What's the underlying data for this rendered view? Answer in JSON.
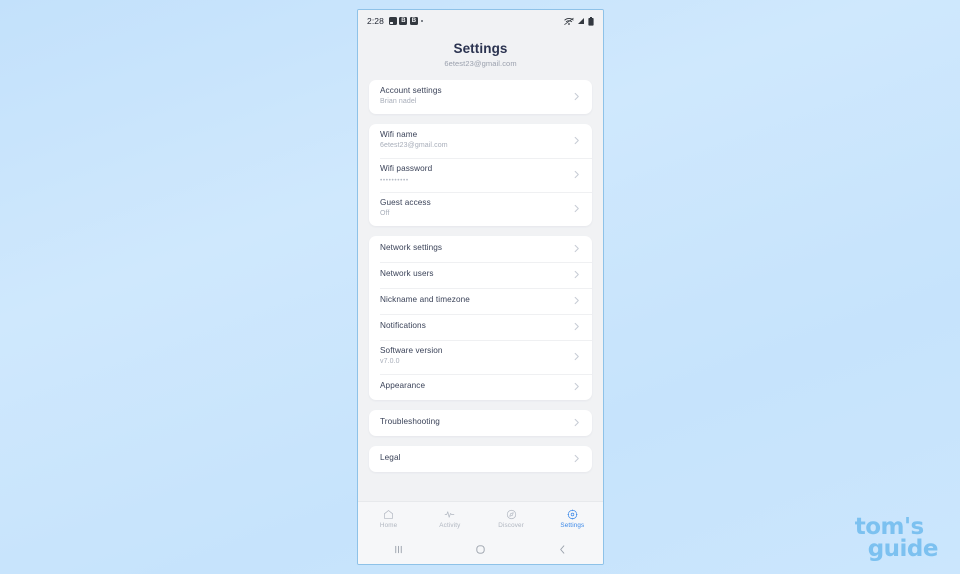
{
  "background": {
    "color_top": "#c3e1fb",
    "color_bottom": "#cbe6fd"
  },
  "phone": {
    "status_bar": {
      "time": "2:28",
      "left_icons": [
        "image-icon",
        "badge-b-icon",
        "badge-b-icon",
        "dot-icon"
      ],
      "badge_letter": "B",
      "right_icons": [
        "wifi-icon",
        "cellular-signal-icon",
        "battery-icon"
      ]
    },
    "header": {
      "title": "Settings",
      "subtitle": "6etest23@gmail.com"
    },
    "cards": [
      {
        "rows": [
          {
            "title": "Account settings",
            "subtitle": "Brian nadel",
            "chevron": true
          }
        ]
      },
      {
        "rows": [
          {
            "title": "Wifi name",
            "subtitle": "6etest23@gmail.com",
            "chevron": true
          },
          {
            "title": "Wifi password",
            "subtitle": "••••••••••",
            "masked": true,
            "chevron": true
          },
          {
            "title": "Guest access",
            "subtitle": "Off",
            "chevron": true
          }
        ]
      },
      {
        "rows": [
          {
            "title": "Network settings",
            "subtitle": "",
            "chevron": true
          },
          {
            "title": "Network users",
            "subtitle": "",
            "chevron": true
          },
          {
            "title": "Nickname and timezone",
            "subtitle": "",
            "chevron": true
          },
          {
            "title": "Notifications",
            "subtitle": "",
            "chevron": true
          },
          {
            "title": "Software version",
            "subtitle": "v7.0.0",
            "chevron": true
          },
          {
            "title": "Appearance",
            "subtitle": "",
            "chevron": true
          }
        ]
      },
      {
        "rows": [
          {
            "title": "Troubleshooting",
            "subtitle": "",
            "chevron": true
          }
        ]
      },
      {
        "rows": [
          {
            "title": "Legal",
            "subtitle": "",
            "chevron": true
          }
        ]
      }
    ],
    "tab_bar": {
      "active_color": "#3b88e8",
      "inactive_color": "#b0b6c0",
      "tabs": [
        {
          "label": "Home",
          "icon": "home-icon",
          "active": false
        },
        {
          "label": "Activity",
          "icon": "activity-pulse-icon",
          "active": false
        },
        {
          "label": "Discover",
          "icon": "discover-compass-icon",
          "active": false
        },
        {
          "label": "Settings",
          "icon": "gear-icon",
          "active": true
        }
      ]
    },
    "android_nav": {
      "buttons": [
        "recents-icon",
        "home-circle-icon",
        "back-chevron-icon"
      ]
    }
  },
  "watermark": {
    "line1": "tom's",
    "line2": "guide",
    "color": "#7cc1f0"
  }
}
